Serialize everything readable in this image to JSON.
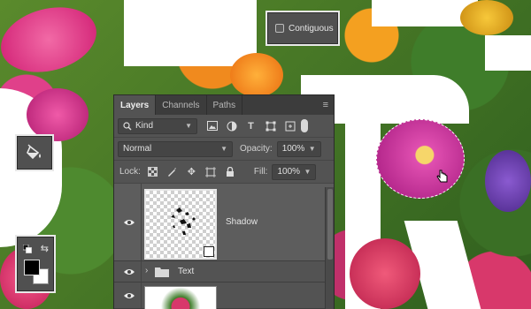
{
  "colors": {
    "panel_bg": "#535353",
    "tab_bar_bg": "#3c3c3c",
    "selected_layer_bg": "#5d5d5d",
    "foreground_color": "#000000",
    "background_color": "#ffffff"
  },
  "options_bar": {
    "contiguous_label": "Contiguous",
    "contiguous_checked": false
  },
  "toolbox": {
    "active_tool_icon": "paint-bucket-icon",
    "color_swatch_icons": [
      "default-colors-icon",
      "swap-colors-icon"
    ]
  },
  "layers_panel": {
    "tabs": [
      {
        "label": "Layers",
        "active": true
      },
      {
        "label": "Channels",
        "active": false
      },
      {
        "label": "Paths",
        "active": false
      }
    ],
    "menu_icon": "panel-menu-icon",
    "filter": {
      "kind_label": "Kind",
      "icons": [
        "search-icon",
        "image-filter-icon",
        "adjustment-filter-icon",
        "type-filter-icon",
        "shape-filter-icon",
        "smart-object-filter-icon"
      ]
    },
    "blend_mode": "Normal",
    "opacity_label": "Opacity:",
    "opacity_value": "100%",
    "lock_label": "Lock:",
    "lock_icons": [
      "lock-transparent-pixels-icon",
      "lock-image-pixels-icon",
      "lock-position-icon",
      "lock-artboard-icon",
      "lock-all-icon"
    ],
    "fill_label": "Fill:",
    "fill_value": "100%",
    "layers": [
      {
        "name": "Shadow",
        "type": "pixel",
        "visible": true,
        "selected": true
      },
      {
        "name": "Text",
        "type": "group",
        "visible": true,
        "selected": false
      },
      {
        "name": "",
        "type": "pixel",
        "visible": true,
        "selected": false
      }
    ]
  }
}
